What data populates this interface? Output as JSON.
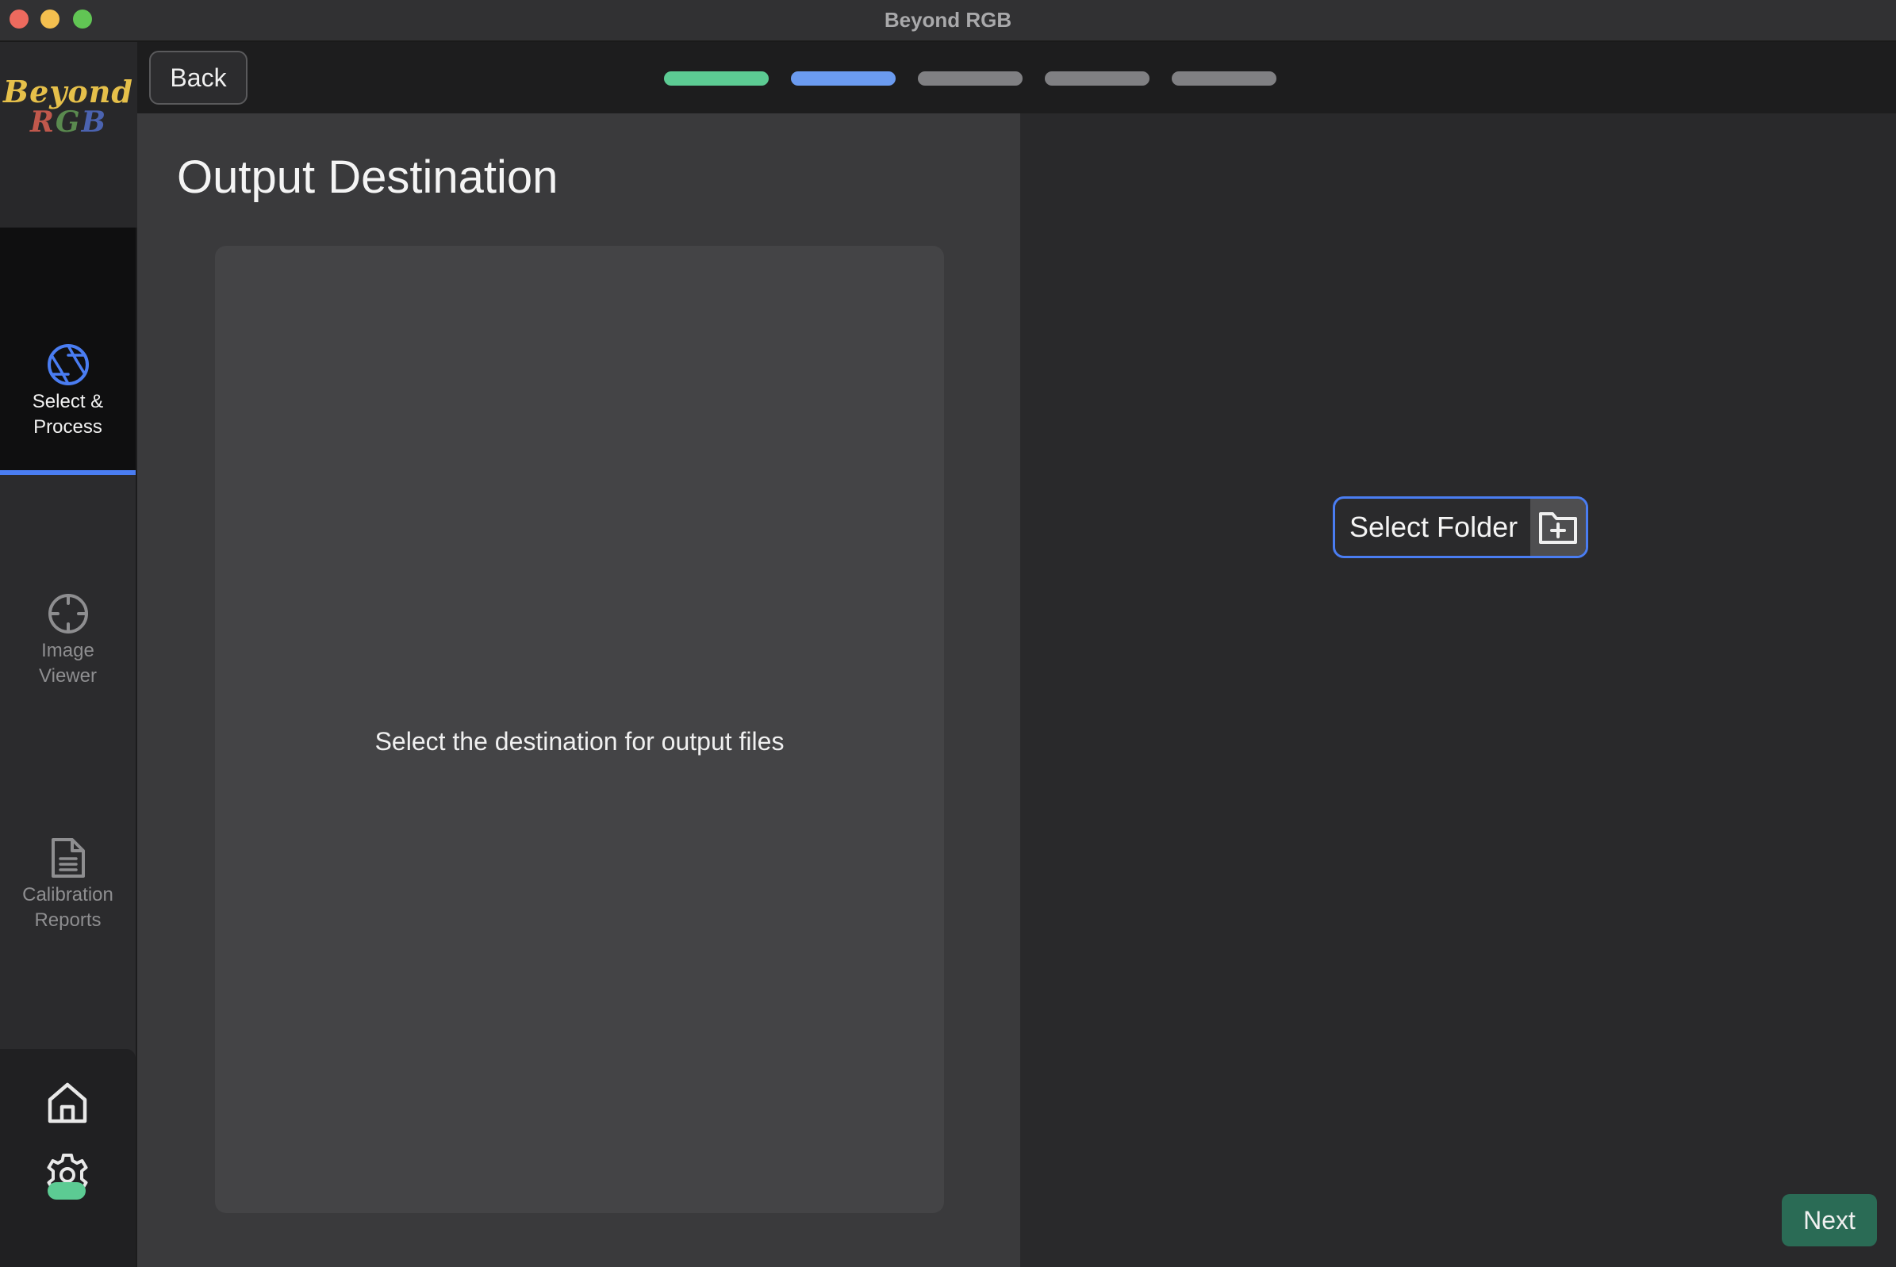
{
  "window": {
    "title": "Beyond RGB"
  },
  "logo": {
    "line1": "Beyond",
    "line2_r": "R",
    "line2_g": "G",
    "line2_b": "B"
  },
  "sidebar": {
    "items": [
      {
        "label_line1": "Select &",
        "label_line2": "Process",
        "icon": "aperture-icon",
        "active": true
      },
      {
        "label_line1": "Image",
        "label_line2": "Viewer",
        "icon": "crosshair-icon",
        "active": false
      },
      {
        "label_line1": "Calibration",
        "label_line2": "Reports",
        "icon": "document-icon",
        "active": false
      }
    ],
    "bottom_icons": [
      "home-icon",
      "gear-icon"
    ],
    "status_color": "#5ccb93"
  },
  "header": {
    "back_label": "Back",
    "steps": [
      {
        "state": "complete",
        "color": "#5ccb93"
      },
      {
        "state": "current",
        "color": "#6b9bf0"
      },
      {
        "state": "pending",
        "color": "#808083"
      },
      {
        "state": "pending",
        "color": "#808083"
      },
      {
        "state": "pending",
        "color": "#808083"
      }
    ]
  },
  "main": {
    "title": "Output Destination",
    "card_text": "Select the destination for output files",
    "select_folder_label": "Select Folder",
    "select_folder_icon": "folder-plus-icon",
    "next_label": "Next"
  },
  "colors": {
    "accent": "#4a7df2",
    "next_button": "#2a6b55"
  }
}
